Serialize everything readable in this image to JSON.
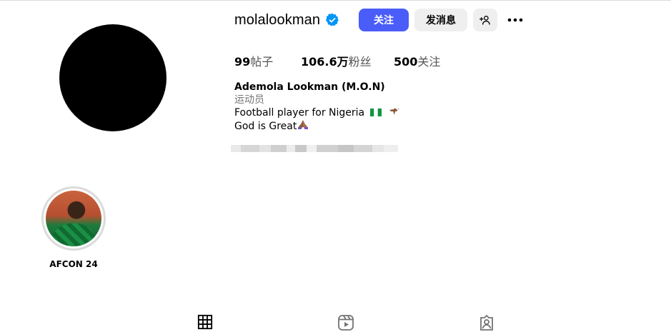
{
  "profile": {
    "username": "molalookman",
    "follow_label": "关注",
    "message_label": "发消息",
    "stats": [
      {
        "value": "99",
        "label": "帖子"
      },
      {
        "value": "106.6万",
        "label": "粉丝"
      },
      {
        "value": "500",
        "label": "关注"
      }
    ],
    "bio": {
      "name": "Ademola Lookman (M.O.N)",
      "category": "运动员",
      "line1": "Football player for Nigeria",
      "line2": "God is Great"
    }
  },
  "highlights": [
    {
      "label": "AFCON 24"
    }
  ],
  "icons": {
    "verified": "verified-badge-icon",
    "add_user": "add-user-icon",
    "more": "more-options-icon",
    "tabs": [
      "grid-icon",
      "reels-icon",
      "tagged-icon"
    ]
  },
  "colors": {
    "accent": "#4a5df9",
    "verified": "#0095f6",
    "secondary_button": "#efefef"
  }
}
